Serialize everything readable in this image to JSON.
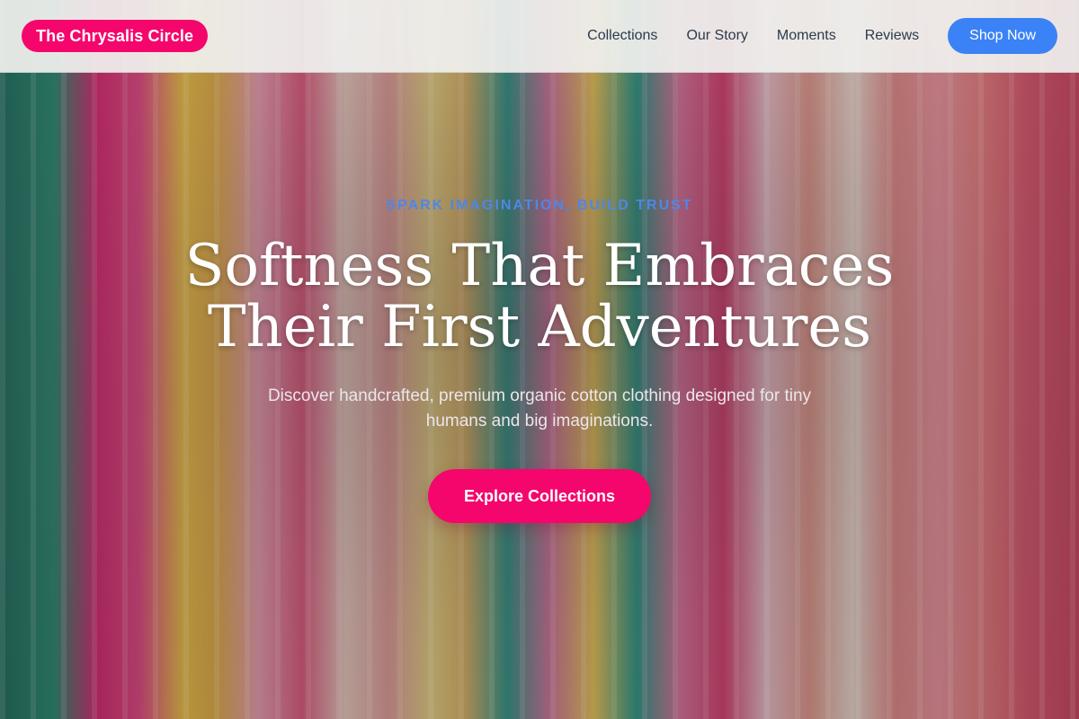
{
  "header": {
    "brand": "The Chrysalis Circle",
    "nav": [
      {
        "label": "Collections"
      },
      {
        "label": "Our Story"
      },
      {
        "label": "Moments"
      },
      {
        "label": "Reviews"
      }
    ],
    "cta_label": "Shop Now"
  },
  "hero": {
    "eyebrow": "SPARK IMAGINATION, BUILD TRUST",
    "headline_line1": "Softness That Embraces",
    "headline_line2": "Their First Adventures",
    "subtext": "Discover handcrafted, premium organic cotton clothing designed for tiny humans and big imaginations.",
    "cta_label": "Explore Collections"
  },
  "colors": {
    "brand_pink": "#f4066c",
    "accent_blue": "#3b82f6",
    "eyebrow_blue": "#4f86e8",
    "nav_text": "#2c3a4b"
  }
}
